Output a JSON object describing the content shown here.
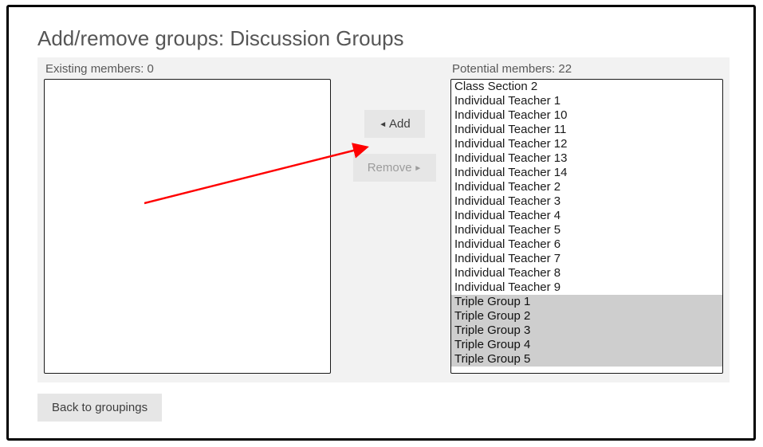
{
  "title": "Add/remove groups: Discussion Groups",
  "existing": {
    "label_prefix": "Existing members: ",
    "count": 0,
    "items": []
  },
  "potential": {
    "label_prefix": "Potential members: ",
    "count": 22,
    "items": [
      {
        "label": "Class Section 2",
        "selected": false
      },
      {
        "label": "Individual Teacher 1",
        "selected": false
      },
      {
        "label": "Individual Teacher 10",
        "selected": false
      },
      {
        "label": "Individual Teacher 11",
        "selected": false
      },
      {
        "label": "Individual Teacher 12",
        "selected": false
      },
      {
        "label": "Individual Teacher 13",
        "selected": false
      },
      {
        "label": "Individual Teacher 14",
        "selected": false
      },
      {
        "label": "Individual Teacher 2",
        "selected": false
      },
      {
        "label": "Individual Teacher 3",
        "selected": false
      },
      {
        "label": "Individual Teacher 4",
        "selected": false
      },
      {
        "label": "Individual Teacher 5",
        "selected": false
      },
      {
        "label": "Individual Teacher 6",
        "selected": false
      },
      {
        "label": "Individual Teacher 7",
        "selected": false
      },
      {
        "label": "Individual Teacher 8",
        "selected": false
      },
      {
        "label": "Individual Teacher 9",
        "selected": false
      },
      {
        "label": "Triple Group 1",
        "selected": true
      },
      {
        "label": "Triple Group 2",
        "selected": true
      },
      {
        "label": "Triple Group 3",
        "selected": true
      },
      {
        "label": "Triple Group 4",
        "selected": true
      },
      {
        "label": "Triple Group 5",
        "selected": true
      }
    ]
  },
  "buttons": {
    "add": "Add",
    "remove": "Remove",
    "back": "Back to groupings"
  }
}
